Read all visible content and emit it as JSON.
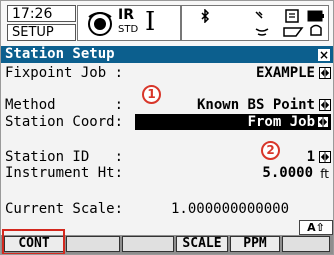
{
  "status": {
    "time": "17:26",
    "mode": "SETUP",
    "reflector": "IR",
    "reflector_sub": "STD",
    "tilt_indicator": "I"
  },
  "window": {
    "title": "Station Setup"
  },
  "form": {
    "fixpoint_job": {
      "label": "Fixpoint Job :",
      "value": "EXAMPLE"
    },
    "method": {
      "label": "Method       :",
      "value": "Known BS Point"
    },
    "station_coord": {
      "label": "Station Coord:",
      "value": "From Job"
    },
    "station_id": {
      "label": "Station ID   :",
      "value": "1"
    },
    "instrument_ht": {
      "label": "Instrument Ht:",
      "value": "5.0000",
      "unit": "ft"
    },
    "current_scale": {
      "label": "Current Scale:",
      "value": "1.000000000000"
    }
  },
  "markers": {
    "one": "1",
    "two": "2"
  },
  "shift_indicator": "A⇧",
  "softkeys": [
    "CONT",
    "",
    "",
    "SCALE",
    "PPM",
    ""
  ],
  "colors": {
    "titlebar": "#0c5f8e",
    "marker": "#d8362a"
  },
  "icons": [
    "reflector-prism-icon",
    "bluetooth-icon",
    "radio-signal-icon",
    "battery-icon",
    "card-icon",
    "lock-icon"
  ]
}
